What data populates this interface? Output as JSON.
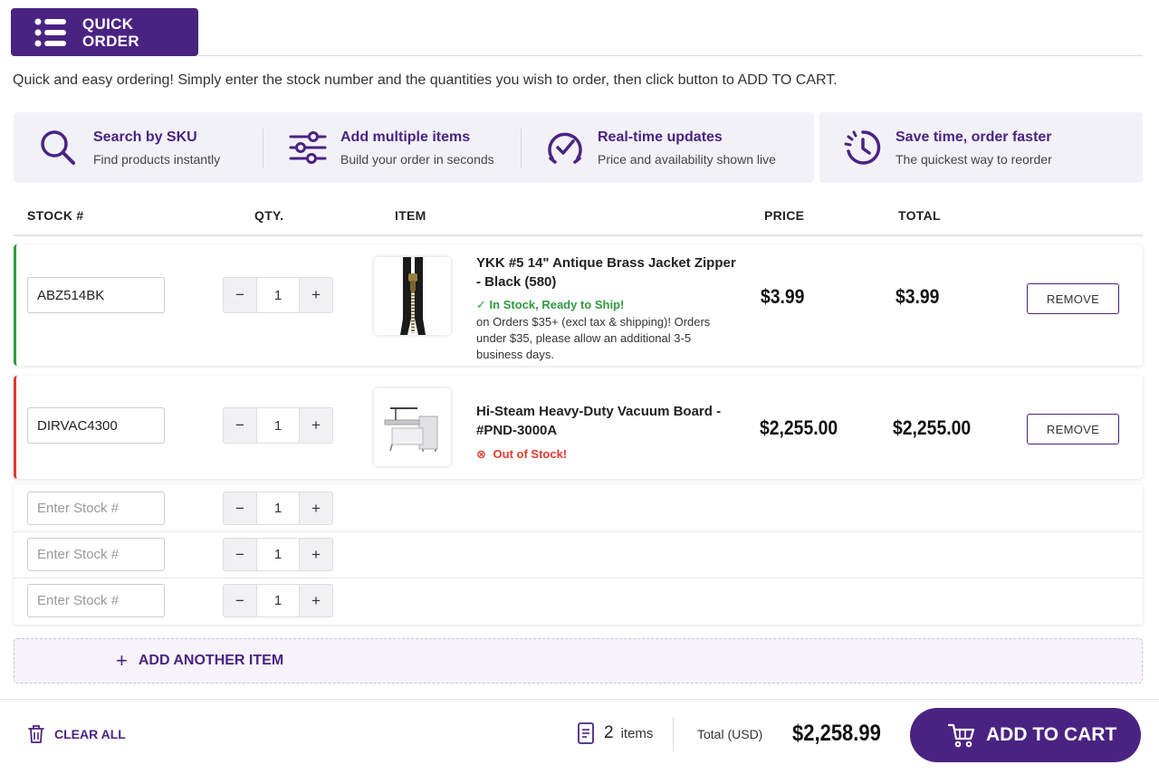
{
  "header": {
    "title_line1": "QUICK",
    "title_line2": "ORDER",
    "icon": "list-icon"
  },
  "intro": "Quick and easy ordering! Simply enter the stock number and the quantities you wish to order, then click button to ADD TO CART.",
  "features": [
    {
      "icon": "search-icon",
      "title": "Search by SKU",
      "subtitle": "Find products instantly"
    },
    {
      "icon": "sliders-icon",
      "title": "Add multiple items",
      "subtitle": "Build your order in seconds"
    },
    {
      "icon": "check-badge-icon",
      "title": "Real-time updates",
      "subtitle": "Price and availability shown live"
    },
    {
      "icon": "history-icon",
      "title": "Save time, order faster",
      "subtitle": "The quickest way to reorder"
    }
  ],
  "table": {
    "headers": {
      "stock": "STOCK #",
      "qty": "QTY.",
      "item": "ITEM",
      "price": "PRICE",
      "total": "TOTAL"
    }
  },
  "rows": [
    {
      "sku": "ABZ514BK",
      "qty": "1",
      "name": "YKK #5 14\" Antique Brass Jacket Zipper - Black (580)",
      "status": "In Stock, Ready to Ship!",
      "note": "on Orders $35+ (excl tax & shipping)! Orders under $35, please allow an additional 3-5 business days.",
      "price": "$3.99",
      "total": "$3.99",
      "remove": "REMOVE"
    },
    {
      "sku": "DIRVAC4300",
      "qty": "1",
      "name": "Hi-Steam Heavy-Duty Vacuum Board - #PND-3000A",
      "status": "Out of Stock!",
      "price": "$2,255.00",
      "total": "$2,255.00",
      "remove": "REMOVE"
    }
  ],
  "empty_rows": [
    {
      "placeholder": "Enter Stock #",
      "qty": "1"
    },
    {
      "placeholder": "Enter Stock #",
      "qty": "1"
    },
    {
      "placeholder": "Enter Stock #",
      "qty": "1"
    }
  ],
  "qty_controls": {
    "minus": "−",
    "plus": "+"
  },
  "add_another": "ADD ANOTHER ITEM",
  "footer": {
    "clear_all": "CLEAR ALL",
    "item_count": "2",
    "items_label": "items",
    "total_label": "Total (USD)",
    "total_value": "$2,258.99",
    "add_to_cart": "ADD TO CART"
  },
  "colors": {
    "brand": "#4a2382",
    "in_stock": "#2f9a3f",
    "out_of_stock": "#e03a2f",
    "feature_bg": "#f3f1f8"
  }
}
